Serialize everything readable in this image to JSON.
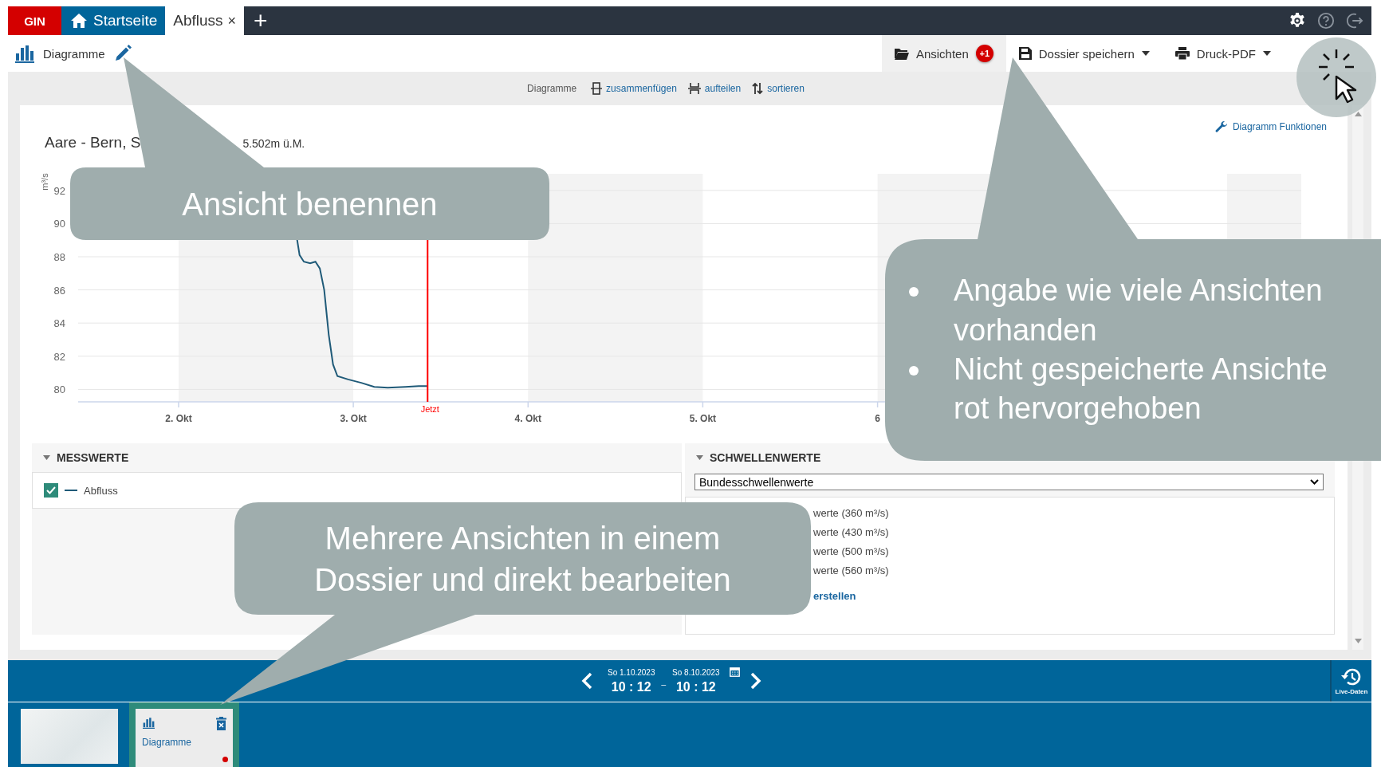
{
  "top_bar": {
    "logo": "GIN",
    "tabs": [
      {
        "kind": "home",
        "label": "Startseite",
        "selected": false
      },
      {
        "kind": "doc",
        "label": "Abfluss",
        "selected": true,
        "close": "×"
      }
    ],
    "add": "+"
  },
  "toolbar": {
    "title": "Diagramme",
    "actions": [
      {
        "kind": "views",
        "label": "Ansichten",
        "badge": "+1",
        "selected": true,
        "dropdown": false
      },
      {
        "kind": "save",
        "label": "Dossier speichern",
        "selected": false,
        "dropdown": true
      },
      {
        "kind": "print",
        "label": "Druck-PDF",
        "selected": false,
        "dropdown": true
      }
    ]
  },
  "subtoolbar": {
    "label": "Diagramme",
    "actions": [
      {
        "kind": "merge",
        "label": "zusammenfügen"
      },
      {
        "kind": "split",
        "label": "aufteilen"
      },
      {
        "kind": "sort",
        "label": "sortieren"
      }
    ]
  },
  "chart": {
    "title_start": "Aare - Bern, S",
    "title_end": "5.502m  ü.M.",
    "functions": "Diagramm Funktionen",
    "chart_data": {
      "type": "line",
      "ylabel": "m³/s",
      "x": [
        2.677,
        2.692,
        2.717,
        2.753,
        2.783,
        2.808,
        2.833,
        2.859,
        2.884,
        2.909,
        2.97,
        3.045,
        3.12,
        3.197,
        3.298,
        3.374,
        3.424
      ],
      "series": [
        {
          "name": "Abfluss",
          "color": "#1f5a78",
          "values": [
            89.1,
            88.1,
            87.7,
            87.6,
            87.7,
            87.3,
            86.0,
            83.3,
            81.5,
            80.8,
            80.6,
            80.4,
            80.15,
            80.1,
            80.15,
            80.2,
            80.2
          ]
        }
      ],
      "xlim": [
        1.425,
        8.425
      ],
      "ylim": [
        79.25,
        93
      ],
      "xticks": [
        {
          "value": 2,
          "label": "2. Okt"
        },
        {
          "value": 3,
          "label": "3. Okt"
        },
        {
          "value": 4,
          "label": "4. Okt"
        },
        {
          "value": 5,
          "label": "5. Okt"
        },
        {
          "value": 6,
          "label": "6"
        }
      ],
      "yticks": [
        80,
        82,
        84,
        86,
        88,
        90,
        92
      ],
      "grid": true,
      "bands": [
        {
          "axis": "x",
          "from": 2,
          "to": 3
        },
        {
          "axis": "x",
          "from": 4,
          "to": 5
        },
        {
          "axis": "x",
          "from": 6,
          "to": 7
        },
        {
          "axis": "x",
          "from": 8,
          "to": 8.425
        }
      ],
      "ref_lines": [
        {
          "axis": "x",
          "value": 3.425,
          "label": "Jetzt",
          "color": "#ff0000"
        }
      ]
    }
  },
  "measurements": {
    "title": "MESSWERTE",
    "expanded": true,
    "items": [
      {
        "checked": true
      }
    ]
  },
  "thresholds": {
    "title": "SCHWELLENWERTE",
    "expanded": true,
    "select": "Bundesschwellenwerte",
    "items": [
      "werte (360 m³/s)",
      "werte (430 m³/s)",
      "werte (500 m³/s)",
      "werte (560 m³/s)"
    ],
    "link": "erstellen"
  },
  "time_bar": {
    "from": {
      "date": "So 1.10.2023",
      "time": "10 : 12"
    },
    "separator": "_",
    "to": {
      "date": "So 8.10.2023",
      "time": "10 : 12"
    },
    "live": "Live-Daten"
  },
  "thumbnails": [
    {
      "kind": "map",
      "selected": false,
      "unsaved": false
    },
    {
      "kind": "chart",
      "label": "Diagramme",
      "selected": true,
      "unsaved": true
    }
  ],
  "callouts": [
    {
      "kind": "text",
      "text": "Ansicht benennen"
    },
    {
      "kind": "bullets",
      "items": [
        "Angabe wie viele Ansichten vorhanden",
        "Nicht gespeicherte Ansichte rot hervorgehoben"
      ]
    },
    {
      "kind": "text",
      "text": "Mehrere Ansichten in einem Dossier und direkt bearbeiten"
    }
  ]
}
